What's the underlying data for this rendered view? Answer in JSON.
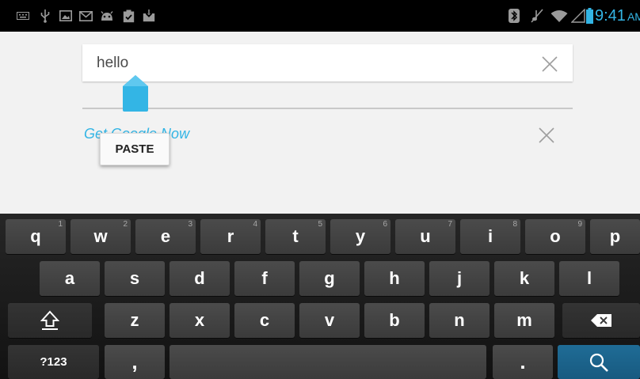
{
  "status_bar": {
    "time": "9:41",
    "time_suffix": "AM",
    "accent_color": "#33b5e5",
    "icons": [
      "keyboard-icon",
      "usb-icon",
      "image-icon",
      "gmail-icon",
      "android-icon",
      "clipboard-icon",
      "download-icon",
      "bluetooth-icon",
      "mute-icon",
      "wifi-icon",
      "signal-icon",
      "battery-icon"
    ]
  },
  "search": {
    "query": "hello",
    "clear_icon": "close-icon"
  },
  "suggestions": {
    "google_now_link": "Get Google Now"
  },
  "context_menu": {
    "paste_label": "PASTE"
  },
  "keyboard": {
    "rows": [
      [
        {
          "label": "q",
          "hint": "1"
        },
        {
          "label": "w",
          "hint": "2"
        },
        {
          "label": "e",
          "hint": "3"
        },
        {
          "label": "r",
          "hint": "4"
        },
        {
          "label": "t",
          "hint": "5"
        },
        {
          "label": "y",
          "hint": "6"
        },
        {
          "label": "u",
          "hint": "7"
        },
        {
          "label": "i",
          "hint": "8"
        },
        {
          "label": "o",
          "hint": "9"
        },
        {
          "label": "p",
          "hint": ""
        }
      ],
      [
        {
          "label": "a"
        },
        {
          "label": "s"
        },
        {
          "label": "d"
        },
        {
          "label": "f"
        },
        {
          "label": "g"
        },
        {
          "label": "h"
        },
        {
          "label": "j"
        },
        {
          "label": "k"
        },
        {
          "label": "l"
        }
      ],
      [
        {
          "label": "shift",
          "icon": "shift-icon"
        },
        {
          "label": "z"
        },
        {
          "label": "x"
        },
        {
          "label": "c"
        },
        {
          "label": "v"
        },
        {
          "label": "b"
        },
        {
          "label": "n"
        },
        {
          "label": "m"
        },
        {
          "label": "backspace",
          "icon": "backspace-icon"
        }
      ],
      [
        {
          "label": "?123"
        },
        {
          "label": ","
        },
        {
          "label": "space"
        },
        {
          "label": "."
        },
        {
          "label": "search",
          "icon": "search-icon"
        }
      ]
    ],
    "action_key_color": "#1f6c96"
  }
}
